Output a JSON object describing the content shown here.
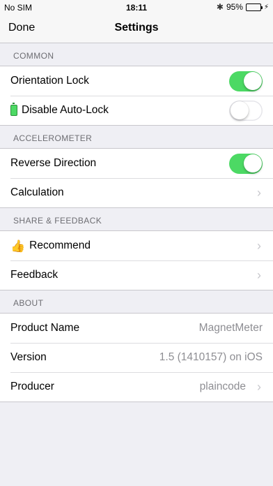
{
  "status_bar": {
    "carrier": "No SIM",
    "time": "18:11",
    "bluetooth_icon": "bluetooth-icon",
    "battery_percent": "95%",
    "battery_level": 0.95,
    "charging_icon": "charging-bolt-icon"
  },
  "nav": {
    "done_label": "Done",
    "title": "Settings"
  },
  "sections": {
    "common": {
      "header": "COMMON",
      "orientation_lock": {
        "label": "Orientation Lock",
        "on": true
      },
      "disable_auto_lock": {
        "label": "Disable Auto-Lock",
        "icon": "battery-icon",
        "on": false
      }
    },
    "accelerometer": {
      "header": "ACCELEROMETER",
      "reverse_direction": {
        "label": "Reverse Direction",
        "on": true
      },
      "calculation": {
        "label": "Calculation"
      }
    },
    "share": {
      "header": "SHARE & FEEDBACK",
      "recommend": {
        "label": "Recommend",
        "icon": "thumbs-up-icon"
      },
      "feedback": {
        "label": "Feedback"
      }
    },
    "about": {
      "header": "ABOUT",
      "product_name": {
        "label": "Product Name",
        "value": "MagnetMeter"
      },
      "version": {
        "label": "Version",
        "value": "1.5 (1410157) on iOS"
      },
      "producer": {
        "label": "Producer",
        "value": "plaincode"
      }
    }
  },
  "colors": {
    "toggle_on": "#4cd964",
    "background": "#efeff4",
    "secondary_text": "#8e8e93"
  }
}
